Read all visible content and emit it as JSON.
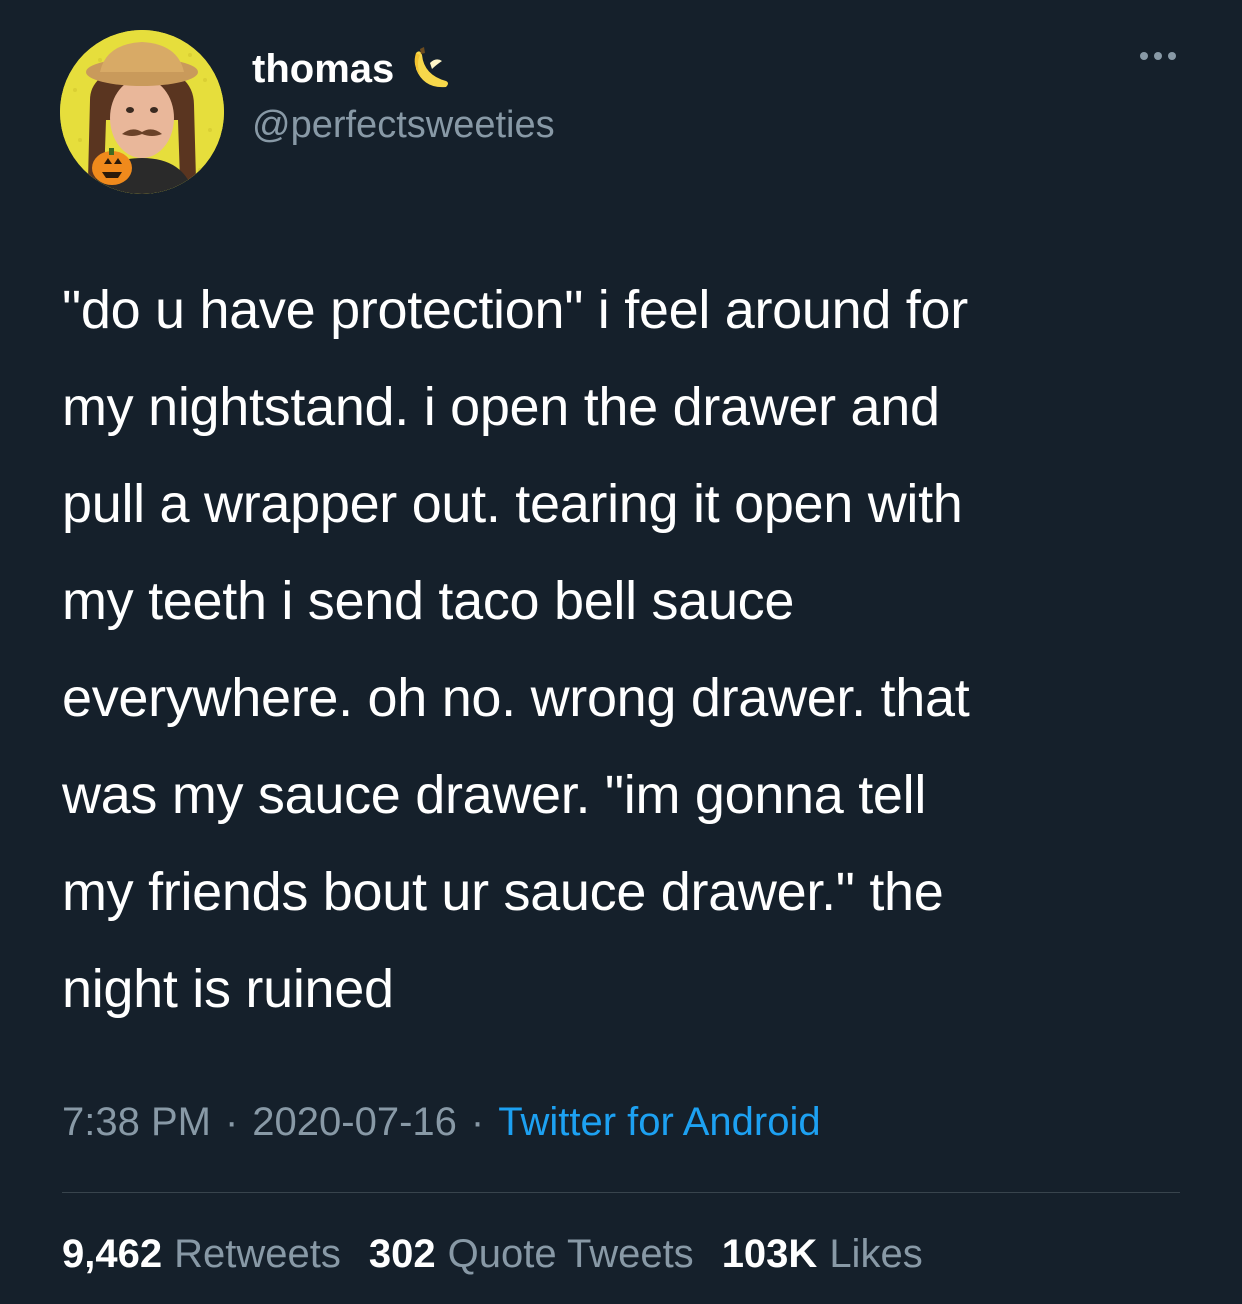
{
  "user": {
    "display_name": "thomas",
    "handle": "@perfectsweeties",
    "name_emoji": "banana-icon"
  },
  "tweet": {
    "text": "\"do u have protection\" i feel around for\nmy nightstand. i open the drawer and\npull a wrapper out. tearing it open with\nmy teeth i send taco bell sauce\neverywhere. oh no. wrong drawer. that\nwas my sauce drawer. \"im gonna tell\nmy friends bout ur sauce drawer.\" the\nnight is ruined",
    "time": "7:38 PM",
    "separator": "·",
    "date": "2020-07-16",
    "source": "Twitter for Android"
  },
  "stats": {
    "retweets_count": "9,462",
    "retweets_label": "Retweets",
    "quotes_count": "302",
    "quotes_label": "Quote Tweets",
    "likes_count": "103K",
    "likes_label": "Likes"
  },
  "colors": {
    "background": "#15202b",
    "secondary_text": "#8899a6",
    "link": "#1da1f2",
    "divider": "#38444d"
  }
}
